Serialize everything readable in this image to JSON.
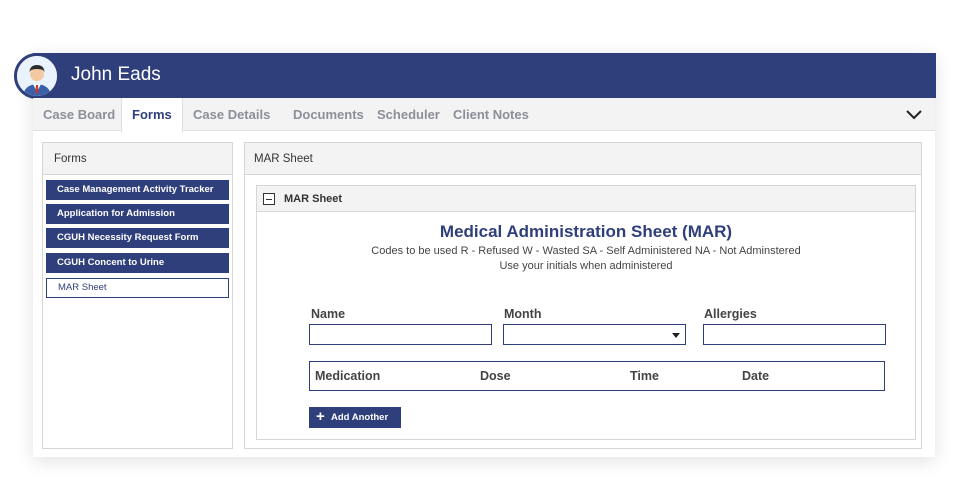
{
  "header": {
    "user_name": "John Eads"
  },
  "tabs": [
    {
      "label": "Case Board"
    },
    {
      "label": "Forms"
    },
    {
      "label": "Case Details"
    },
    {
      "label": "Documents"
    },
    {
      "label": "Scheduler"
    },
    {
      "label": "Client Notes"
    }
  ],
  "forms_panel": {
    "title": "Forms",
    "items": [
      {
        "label": "Case Management Activity Tracker"
      },
      {
        "label": "Application for Admission"
      },
      {
        "label": "CGUH Necessity Request Form"
      },
      {
        "label": "CGUH Concent to Urine"
      },
      {
        "label": "MAR Sheet"
      }
    ]
  },
  "main_panel": {
    "title": "MAR Sheet",
    "section_title": "MAR Sheet",
    "form_title": "Medical Administration Sheet (MAR)",
    "codes_line": "Codes to be used R - Refused  W - Wasted  SA - Self Administered  NA - Not Adminstered",
    "initials_line": "Use your initials when administered",
    "fields": {
      "name_label": "Name",
      "name_value": "",
      "month_label": "Month",
      "month_value": "",
      "allergies_label": "Allergies",
      "allergies_value": ""
    },
    "medication_table": {
      "columns": [
        "Medication",
        "Dose",
        "Time",
        "Date"
      ]
    },
    "add_button_label": "Add Another"
  },
  "colors": {
    "primary": "#2f3f7b",
    "tab_bg": "#f3f3f4"
  }
}
